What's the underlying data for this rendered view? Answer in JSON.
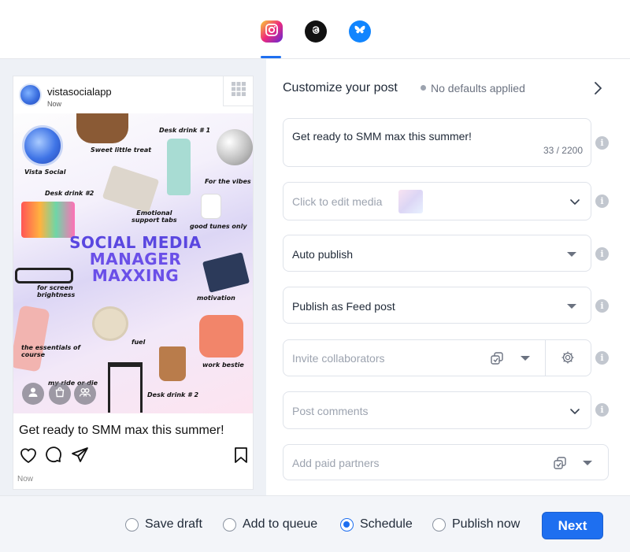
{
  "networks": {
    "tabs": [
      {
        "name": "Instagram",
        "icon": "instagram-icon",
        "active": true
      },
      {
        "name": "Threads",
        "icon": "threads-icon",
        "active": false
      },
      {
        "name": "Bluesky",
        "icon": "bluesky-icon",
        "active": false
      }
    ],
    "accent": "#1e6ff0"
  },
  "preview": {
    "username": "vistasocialapp",
    "time_top": "Now",
    "caption": "Get ready to SMM max this summer!",
    "time_bottom": "Now",
    "image_text": {
      "headline": [
        "SOCIAL MEDIA",
        "MANAGER",
        "MAXXING"
      ],
      "labels": {
        "sweet_treat": "Sweet little treat",
        "desk_drink_1": "Desk drink # 1",
        "vista_social": "Vista Social",
        "for_the_vibes": "For the vibes",
        "desk_drink_2a": "Desk drink #2",
        "emotional_support": "Emotional\nsupport tabs",
        "good_tunes": "good tunes only",
        "screen_brightness": "for screen\nbrightness",
        "motivation": "motivation",
        "fuel": "fuel",
        "essentials": "the essentials of\ncourse",
        "work_bestie": "work bestie",
        "ride_or_die": "my ride or die",
        "desk_drink_2b": "Desk drink # 2"
      }
    }
  },
  "customize": {
    "title": "Customize your post",
    "status": "No defaults applied",
    "caption_value": "Get ready to SMM max this summer!",
    "caption_counter": "33 / 2200",
    "media_placeholder": "Click to edit media",
    "publish_mode": "Auto publish",
    "publish_as": "Publish as Feed post",
    "collaborators_placeholder": "Invite collaborators",
    "comments_placeholder": "Post comments",
    "partners_placeholder": "Add paid partners"
  },
  "footer": {
    "options": [
      {
        "label": "Save draft",
        "selected": false
      },
      {
        "label": "Add to queue",
        "selected": false
      },
      {
        "label": "Schedule",
        "selected": true
      },
      {
        "label": "Publish now",
        "selected": false
      }
    ],
    "next_label": "Next"
  }
}
